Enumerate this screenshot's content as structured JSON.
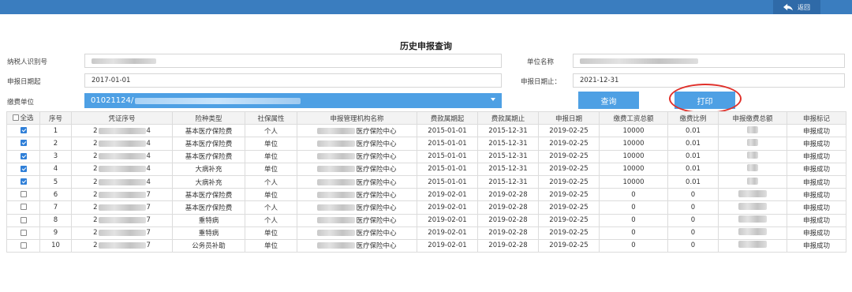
{
  "topbar": {
    "back_label": "返回",
    "back_icon": "back-arrow-icon"
  },
  "page_title": "历史申报查询",
  "form": {
    "taxpayer_id_label": "纳税人识别号",
    "unit_name_label": "单位名称",
    "date_from_label": "申报日期起",
    "date_from_value": "2017-01-01",
    "date_to_label": "申报日期止：",
    "date_to_value": "2021-12-31",
    "payer_unit_label": "缴费单位",
    "payer_unit_value": "01021124/"
  },
  "buttons": {
    "query": "查询",
    "print": "打印"
  },
  "table": {
    "select_all_label": "全选",
    "headers": [
      "序号",
      "凭证序号",
      "险种类型",
      "社保属性",
      "申报管理机构名称",
      "费款属期起",
      "费款属期止",
      "申报日期",
      "缴费工资总额",
      "缴费比例",
      "申报缴费总额",
      "申报标记"
    ],
    "rows": [
      {
        "checked": true,
        "no": "1",
        "voucher_head": "2",
        "voucher_tail": "4",
        "type": "基本医疗保险费",
        "attr": "个人",
        "org_tail": "医疗保险中心",
        "from": "2015-01-01",
        "to": "2015-12-31",
        "date": "2019-02-25",
        "wage": "10000",
        "ratio": "0.01",
        "status": "申报成功"
      },
      {
        "checked": true,
        "no": "2",
        "voucher_head": "2",
        "voucher_tail": "4",
        "type": "基本医疗保险费",
        "attr": "单位",
        "org_tail": "医疗保险中心",
        "from": "2015-01-01",
        "to": "2015-12-31",
        "date": "2019-02-25",
        "wage": "10000",
        "ratio": "0.01",
        "status": "申报成功"
      },
      {
        "checked": true,
        "no": "3",
        "voucher_head": "2",
        "voucher_tail": "4",
        "type": "基本医疗保险费",
        "attr": "单位",
        "org_tail": "医疗保险中心",
        "from": "2015-01-01",
        "to": "2015-12-31",
        "date": "2019-02-25",
        "wage": "10000",
        "ratio": "0.01",
        "status": "申报成功"
      },
      {
        "checked": true,
        "no": "4",
        "voucher_head": "2",
        "voucher_tail": "4",
        "type": "大病补充",
        "attr": "单位",
        "org_tail": "医疗保险中心",
        "from": "2015-01-01",
        "to": "2015-12-31",
        "date": "2019-02-25",
        "wage": "10000",
        "ratio": "0.01",
        "status": "申报成功"
      },
      {
        "checked": true,
        "no": "5",
        "voucher_head": "2",
        "voucher_tail": "4",
        "type": "大病补充",
        "attr": "个人",
        "org_tail": "医疗保险中心",
        "from": "2015-01-01",
        "to": "2015-12-31",
        "date": "2019-02-25",
        "wage": "10000",
        "ratio": "0.01",
        "status": "申报成功"
      },
      {
        "checked": false,
        "no": "6",
        "voucher_head": "2",
        "voucher_tail": "7",
        "type": "基本医疗保险费",
        "attr": "单位",
        "org_tail": "医疗保险中心",
        "from": "2019-02-01",
        "to": "2019-02-28",
        "date": "2019-02-25",
        "wage": "0",
        "ratio": "0",
        "status": "申报成功"
      },
      {
        "checked": false,
        "no": "7",
        "voucher_head": "2",
        "voucher_tail": "7",
        "type": "基本医疗保险费",
        "attr": "个人",
        "org_tail": "医疗保险中心",
        "from": "2019-02-01",
        "to": "2019-02-28",
        "date": "2019-02-25",
        "wage": "0",
        "ratio": "0",
        "status": "申报成功"
      },
      {
        "checked": false,
        "no": "8",
        "voucher_head": "2",
        "voucher_tail": "7",
        "type": "重特病",
        "attr": "个人",
        "org_tail": "医疗保险中心",
        "from": "2019-02-01",
        "to": "2019-02-28",
        "date": "2019-02-25",
        "wage": "0",
        "ratio": "0",
        "status": "申报成功"
      },
      {
        "checked": false,
        "no": "9",
        "voucher_head": "2",
        "voucher_tail": "7",
        "type": "重特病",
        "attr": "单位",
        "org_tail": "医疗保险中心",
        "from": "2019-02-01",
        "to": "2019-02-28",
        "date": "2019-02-25",
        "wage": "0",
        "ratio": "0",
        "status": "申报成功"
      },
      {
        "checked": false,
        "no": "10",
        "voucher_head": "2",
        "voucher_tail": "7",
        "type": "公务员补助",
        "attr": "单位",
        "org_tail": "医疗保险中心",
        "from": "2019-02-01",
        "to": "2019-02-28",
        "date": "2019-02-25",
        "wage": "0",
        "ratio": "0",
        "status": "申报成功"
      }
    ]
  }
}
